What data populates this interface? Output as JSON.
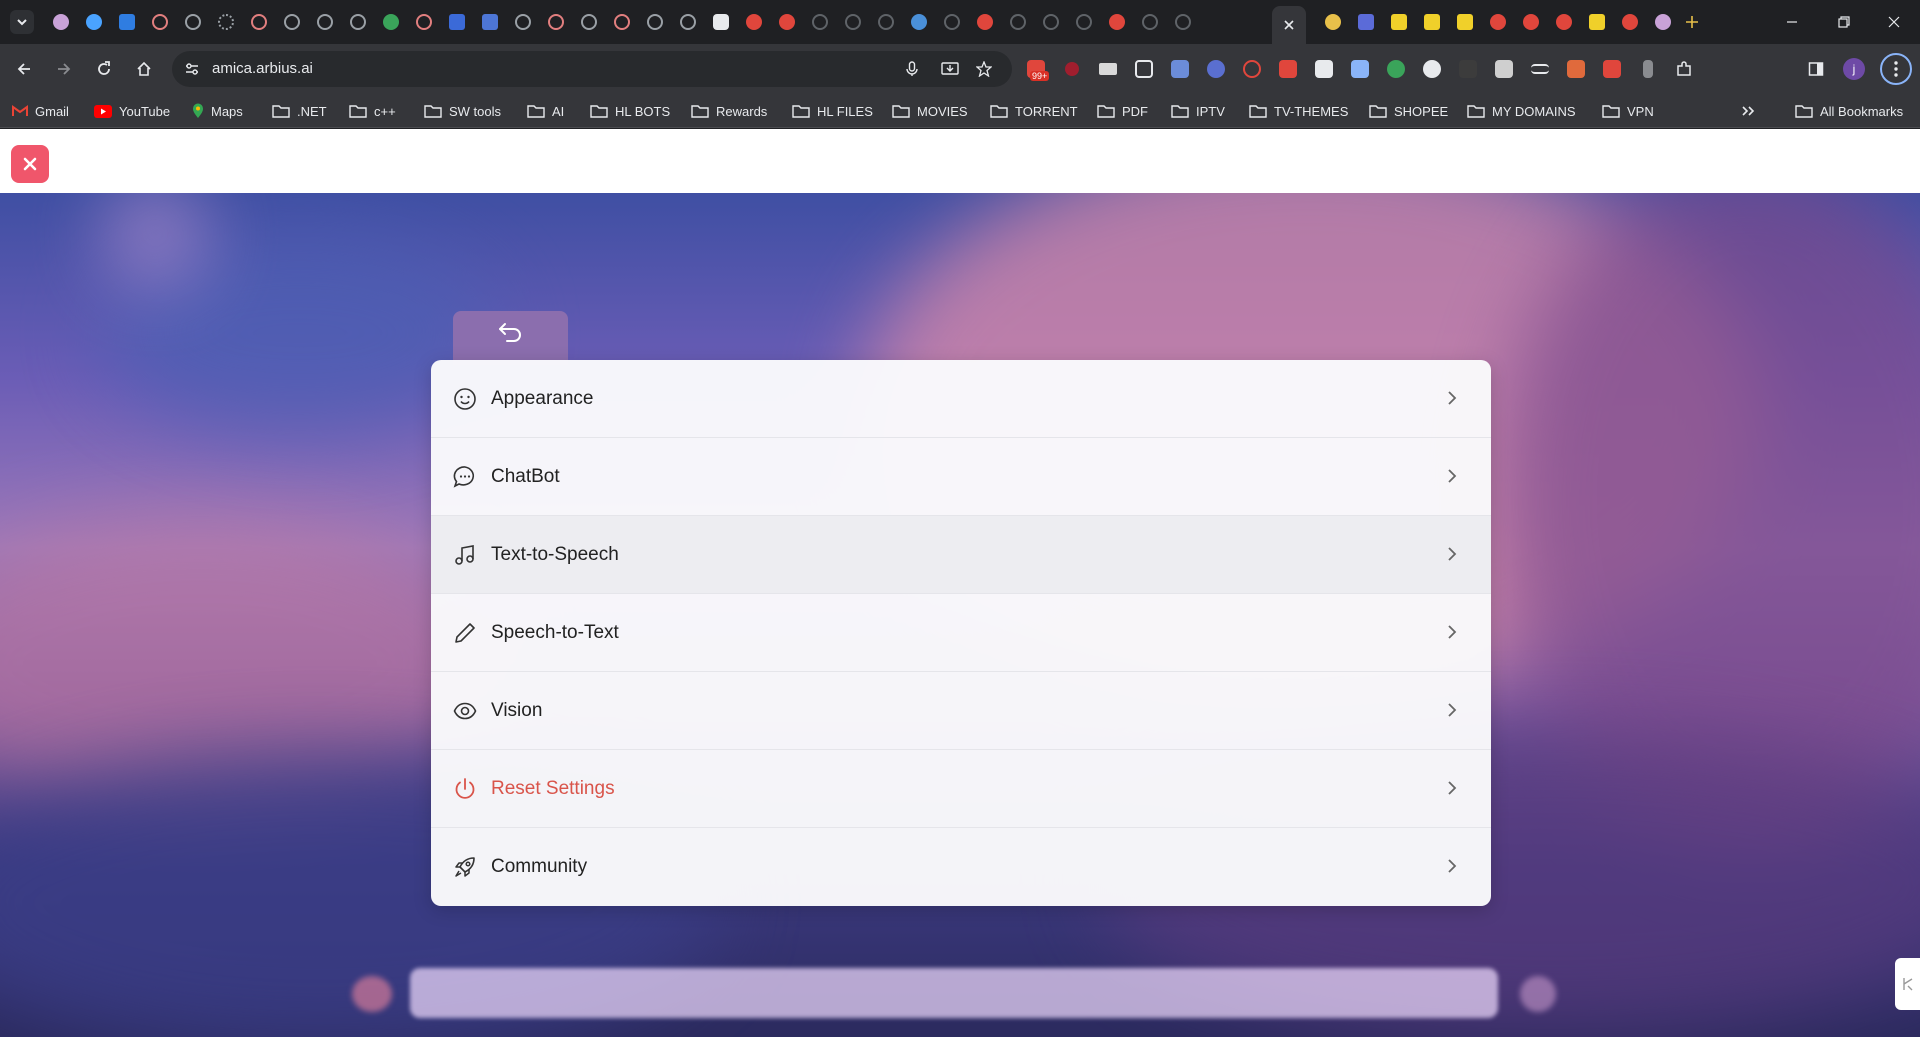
{
  "browser": {
    "url": "amica.arbius.ai",
    "profile_initial": "j",
    "extension_badge": "99+",
    "bookmarks": [
      {
        "label": "Gmail",
        "icon": "gmail-icon"
      },
      {
        "label": "YouTube",
        "icon": "youtube-icon"
      },
      {
        "label": "Maps",
        "icon": "maps-icon"
      },
      {
        "label": ".NET",
        "icon": "folder-icon"
      },
      {
        "label": "c++",
        "icon": "folder-icon"
      },
      {
        "label": "SW tools",
        "icon": "folder-icon"
      },
      {
        "label": "AI",
        "icon": "folder-icon"
      },
      {
        "label": "HL BOTS",
        "icon": "folder-icon"
      },
      {
        "label": "Rewards",
        "icon": "folder-icon"
      },
      {
        "label": "HL FILES",
        "icon": "folder-icon"
      },
      {
        "label": "MOVIES",
        "icon": "folder-icon"
      },
      {
        "label": "TORRENT",
        "icon": "folder-icon"
      },
      {
        "label": "PDF",
        "icon": "folder-icon"
      },
      {
        "label": "IPTV",
        "icon": "folder-icon"
      },
      {
        "label": "TV-THEMES",
        "icon": "folder-icon"
      },
      {
        "label": "SHOPEE",
        "icon": "folder-icon"
      },
      {
        "label": "MY DOMAINS",
        "icon": "folder-icon"
      },
      {
        "label": "VPN",
        "icon": "folder-icon"
      }
    ],
    "all_bookmarks": "All Bookmarks"
  },
  "settings_menu": {
    "items": [
      {
        "label": "Appearance",
        "icon": "smiley-face-icon"
      },
      {
        "label": "ChatBot",
        "icon": "chat-bubble-icon"
      },
      {
        "label": "Text-to-Speech",
        "icon": "music-note-icon"
      },
      {
        "label": "Speech-to-Text",
        "icon": "pencil-icon"
      },
      {
        "label": "Vision",
        "icon": "eye-icon"
      },
      {
        "label": "Reset Settings",
        "icon": "power-icon"
      },
      {
        "label": "Community",
        "icon": "rocket-icon"
      }
    ],
    "hovered_item": "Text-to-Speech"
  },
  "colors": {
    "close_button": "#f0566b",
    "back_tab": "#8b6eae",
    "danger_text": "#d9544a"
  }
}
